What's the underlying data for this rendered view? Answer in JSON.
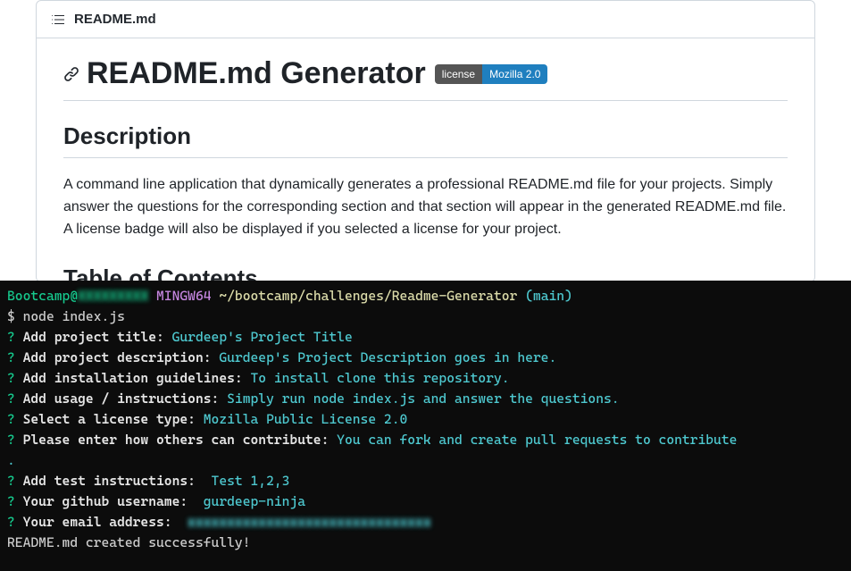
{
  "readme": {
    "filename": "README.md",
    "title": "README.md Generator",
    "badge": {
      "left": "license",
      "right": "Mozilla 2.0"
    },
    "section_description_heading": "Description",
    "description_text": "A command line application that dynamically generates a professional README.md file for your projects. Simply answer the questions for the corresponding section and that section will appear in the generated README.md file. A license badge will also be displayed if you selected a license for your project.",
    "cutoff_heading": "Table of Contents"
  },
  "terminal": {
    "prompt_user": "Bootcamp@",
    "prompt_host_blur": "XXXXXXXXX",
    "prompt_shell": "MINGW64",
    "prompt_path": "~/bootcamp/challenges/Readme-Generator",
    "prompt_branch": "(main)",
    "cmd_symbol": "$",
    "command": "node index.js",
    "lines": [
      {
        "q": "Add project title:",
        "a": "Gurdeep's Project Title"
      },
      {
        "q": "Add project description:",
        "a": "Gurdeep's Project Description goes in here."
      },
      {
        "q": "Add installation guidelines:",
        "a": "To install clone this repository."
      },
      {
        "q": "Add usage / instructions:",
        "a": "Simply run node index.js and answer the questions."
      },
      {
        "q": "Select a license type:",
        "a": "Mozilla Public License 2.0"
      },
      {
        "q": "Please enter how others can contribute:",
        "a": "You can fork and create pull requests to contribute"
      }
    ],
    "dot": ".",
    "lines2": [
      {
        "q": "Add test instructions:",
        "a": " Test 1,2,3"
      },
      {
        "q": "Your github username:",
        "a": " gurdeep-ninja"
      }
    ],
    "email_q": "Your email address:",
    "email_blur": "xxxxxxxxxxxxxxxxxxxxxxxxxxxxxxx",
    "success": "README.md created successfully!"
  }
}
